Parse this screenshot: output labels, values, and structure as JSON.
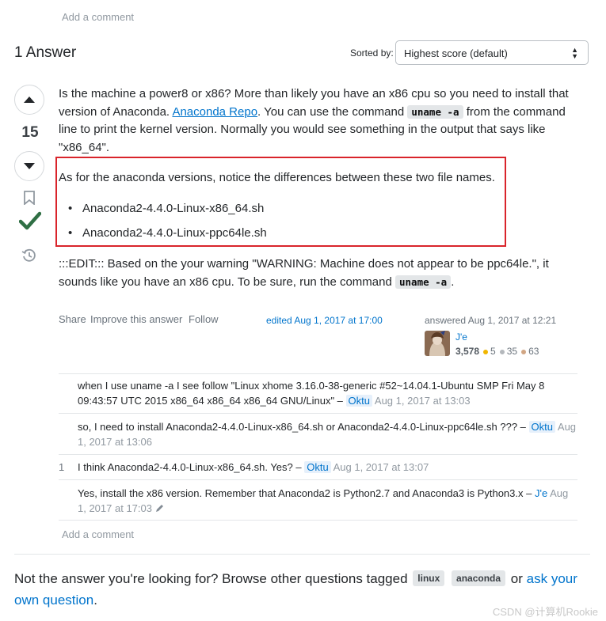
{
  "top_add_comment": "Add a comment",
  "answers_header": "1 Answer",
  "sort": {
    "label": "Sorted by:",
    "value": "Highest score (default)"
  },
  "vote": {
    "score": "15"
  },
  "answer": {
    "p1_a": "Is the machine a power8 or x86? More than likely you have an x86 cpu so you need to install that version of Anaconda.",
    "p1_link": "Anaconda Repo",
    "p1_b": ". You can use the command",
    "p1_code": "uname -a",
    "p1_c": "from the command line to print the kernel version. Normally you would see something in the output that says like \"x86_64\".",
    "p2": "As for the anaconda versions, notice the differences between these two file names.",
    "files": [
      "Anaconda2-4.4.0-Linux-x86_64.sh",
      "Anaconda2-4.4.0-Linux-ppc64le.sh"
    ],
    "p3_a": ":::EDIT::: Based on the your warning \"WARNING: Machine does not appear to be ppc64le.\", it sounds like you have an x86 cpu. To be sure, run the command",
    "p3_code": "uname -a",
    "p3_b": "."
  },
  "post_menu": {
    "share": "Share",
    "improve": "Improve this answer",
    "follow": "Follow"
  },
  "edited": "edited Aug 1, 2017 at 17:00",
  "answered": "answered Aug 1, 2017 at 12:21",
  "user": {
    "name": "J'e",
    "rep": "3,578",
    "gold": "5",
    "silver": "35",
    "bronze": "63"
  },
  "comments": [
    {
      "score": "",
      "text": "when I use uname -a I see follow \"Linux xhome 3.16.0-38-generic #52~14.04.1-Ubuntu SMP Fri May 8 09:43:57 UTC 2015 x86_64 x86_64 x86_64 GNU/Linux\" –",
      "user": "Oktu",
      "time": "Aug 1, 2017 at 13:03"
    },
    {
      "score": "",
      "text": "so, I need to install Anaconda2-4.4.0-Linux-x86_64.sh or Anaconda2-4.4.0-Linux-ppc64le.sh ??? –",
      "user": "Oktu",
      "time": "Aug 1, 2017 at 13:06"
    },
    {
      "score": "1",
      "text": "I think Anaconda2-4.4.0-Linux-x86_64.sh. Yes? –",
      "user": "Oktu",
      "time": "Aug 1, 2017 at 13:07"
    },
    {
      "score": "",
      "text": "Yes, install the x86 version. Remember that Anaconda2 is Python2.7 and Anaconda3 is Python3.x –",
      "user": "J'e",
      "time": "Aug 1, 2017 at 17:03"
    }
  ],
  "bottom_add_comment": "Add a comment",
  "footer": {
    "text_a": "Not the answer you're looking for? Browse other questions tagged",
    "tags": [
      "linux",
      "anaconda"
    ],
    "text_b": "or",
    "link": "ask your own question",
    "text_c": "."
  },
  "watermark": "CSDN @计算机Rookie",
  "colors": {
    "accept": "#2f6f44",
    "link": "#0074cc",
    "highlight_border": "#d9242b"
  }
}
